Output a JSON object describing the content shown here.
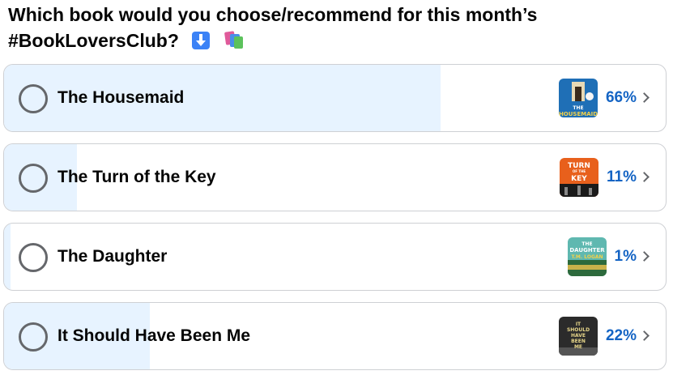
{
  "question": {
    "line1": "Which book would you choose/recommend for this month’s",
    "line2": "#BookLoversClub?",
    "icons": [
      "down-arrow-icon",
      "books-icon"
    ]
  },
  "options": [
    {
      "label": "The Housemaid",
      "percent": 66,
      "percent_text": "66%",
      "cover_text": "THE HOUSEMAID",
      "cover_colors": [
        "#1f6fb6",
        "#0d3c7a"
      ]
    },
    {
      "label": "The Turn of the Key",
      "percent": 11,
      "percent_text": "11%",
      "cover_text": "TURN KEY",
      "cover_colors": [
        "#e8601c",
        "#1a1a1a"
      ]
    },
    {
      "label": "The Daughter",
      "percent": 1,
      "percent_text": "1%",
      "cover_text": "THE DAUGHTER",
      "cover_colors": [
        "#5fb8b0",
        "#2d6a3c"
      ]
    },
    {
      "label": "It Should Have Been Me",
      "percent": 22,
      "percent_text": "22%",
      "cover_text": "IT SHOULD HAVE BEEN ME",
      "cover_colors": [
        "#2b2b2b",
        "#7a6a3a"
      ]
    }
  ],
  "colors": {
    "fill": "#e7f3ff",
    "percent": "#1464c4",
    "border": "#ced0d4"
  }
}
